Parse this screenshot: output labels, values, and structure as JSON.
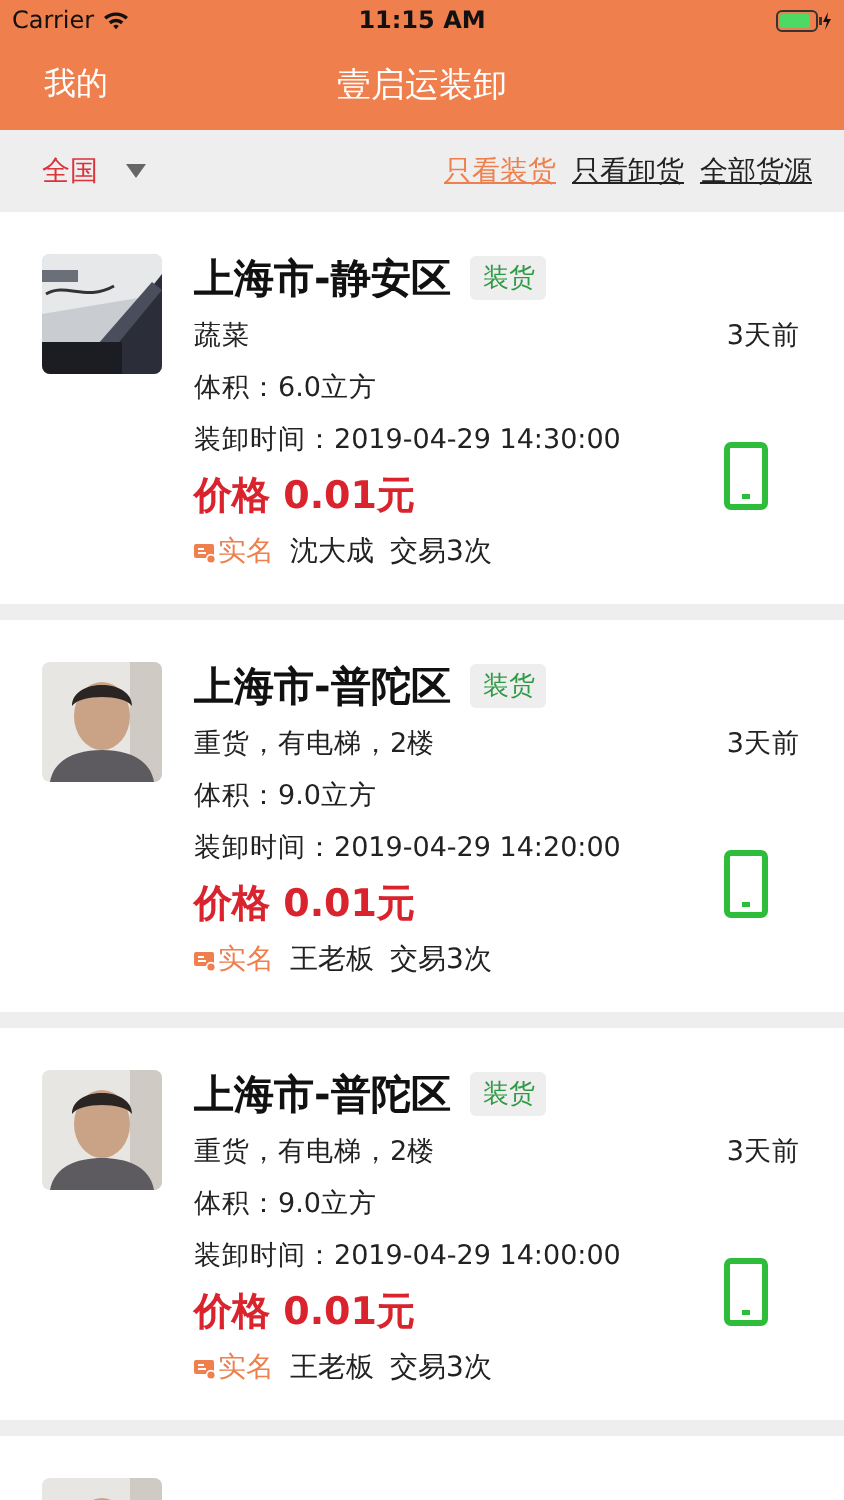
{
  "status_bar": {
    "carrier": "Carrier",
    "time": "11:15 AM"
  },
  "nav": {
    "left": "我的",
    "title": "壹启运装卸"
  },
  "filter": {
    "region": "全国",
    "tabs": [
      {
        "label": "只看装货",
        "selected": true
      },
      {
        "label": "只看卸货",
        "selected": false
      },
      {
        "label": "全部货源",
        "selected": false
      }
    ]
  },
  "cards": [
    {
      "avatar": {
        "kind": "picture"
      },
      "location": "上海市-静安区",
      "tag": "装货",
      "description": "蔬菜",
      "volume": "体积：6.0立方",
      "time": "装卸时间：2019-04-29 14:30:00",
      "price": "价格 0.01元",
      "badge": "实名",
      "name": "沈大成",
      "trades": "交易3次",
      "ago": "3天前"
    },
    {
      "avatar": {
        "kind": "picture"
      },
      "location": "上海市-普陀区",
      "tag": "装货",
      "description": "重货，有电梯，2楼",
      "volume": "体积：9.0立方",
      "time": "装卸时间：2019-04-29 14:20:00",
      "price": "价格 0.01元",
      "badge": "实名",
      "name": "王老板",
      "trades": "交易3次",
      "ago": "3天前"
    },
    {
      "avatar": {
        "kind": "picture"
      },
      "location": "上海市-普陀区",
      "tag": "装货",
      "description": "重货，有电梯，2楼",
      "volume": "体积：9.0立方",
      "time": "装卸时间：2019-04-29 14:00:00",
      "price": "价格 0.01元",
      "badge": "实名",
      "name": "王老板",
      "trades": "交易3次",
      "ago": "3天前"
    },
    {
      "avatar": {
        "kind": "picture"
      }
    }
  ]
}
